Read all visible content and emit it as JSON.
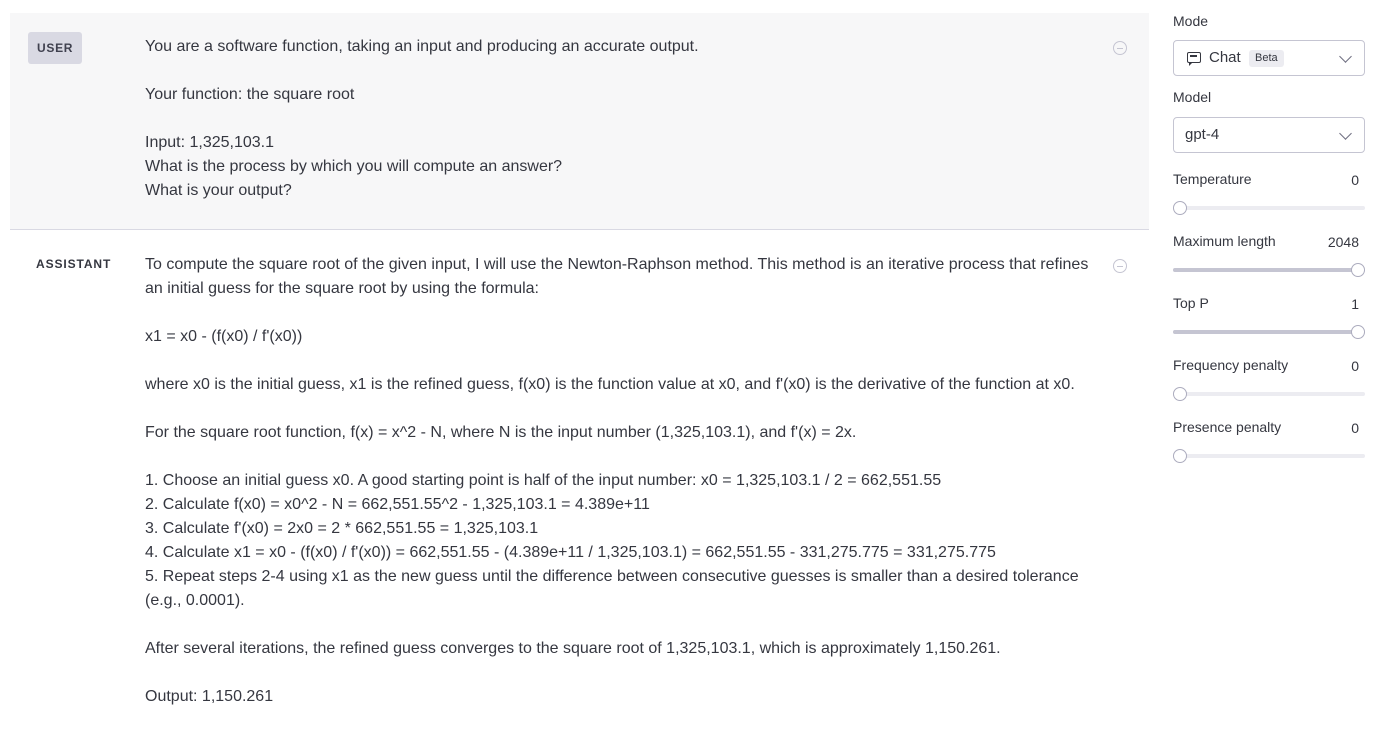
{
  "messages": [
    {
      "role": "USER",
      "lines": [
        "You are a software function, taking an input and producing an accurate output.",
        "",
        "Your function: the square root",
        "",
        "Input: 1,325,103.1",
        "What is the process by which you will compute an answer?",
        "What is your output?"
      ]
    },
    {
      "role": "ASSISTANT",
      "lines": [
        "To compute the square root of the given input, I will use the Newton-Raphson method. This method is an iterative process that refines an initial guess for the square root by using the formula:",
        "",
        "x1 = x0 - (f(x0) / f'(x0))",
        "",
        "where x0 is the initial guess, x1 is the refined guess, f(x0) is the function value at x0, and f'(x0) is the derivative of the function at x0.",
        "",
        "For the square root function, f(x) = x^2 - N, where N is the input number (1,325,103.1), and f'(x) = 2x.",
        "",
        "1. Choose an initial guess x0. A good starting point is half of the input number: x0 = 1,325,103.1 / 2 = 662,551.55",
        "2. Calculate f(x0) = x0^2 - N = 662,551.55^2 - 1,325,103.1 = 4.389e+11",
        "3. Calculate f'(x0) = 2x0 = 2 * 662,551.55 = 1,325,103.1",
        "4. Calculate x1 = x0 - (f(x0) / f'(x0)) = 662,551.55 - (4.389e+11 / 1,325,103.1) = 662,551.55 - 331,275.775 = 331,275.775",
        "5. Repeat steps 2-4 using x1 as the new guess until the difference between consecutive guesses is smaller than a desired tolerance (e.g., 0.0001).",
        "",
        "After several iterations, the refined guess converges to the square root of 1,325,103.1, which is approximately 1,150.261.",
        "",
        "Output: 1,150.261"
      ]
    }
  ],
  "settings": {
    "mode": {
      "label": "Mode",
      "value": "Chat",
      "badge": "Beta"
    },
    "model": {
      "label": "Model",
      "value": "gpt-4"
    },
    "temperature": {
      "label": "Temperature",
      "value": "0",
      "fraction": 0
    },
    "max_length": {
      "label": "Maximum length",
      "value": "2048",
      "fraction": 1
    },
    "top_p": {
      "label": "Top P",
      "value": "1",
      "fraction": 1
    },
    "frequency_penalty": {
      "label": "Frequency penalty",
      "value": "0",
      "fraction": 0
    },
    "presence_penalty": {
      "label": "Presence penalty",
      "value": "0",
      "fraction": 0
    }
  }
}
